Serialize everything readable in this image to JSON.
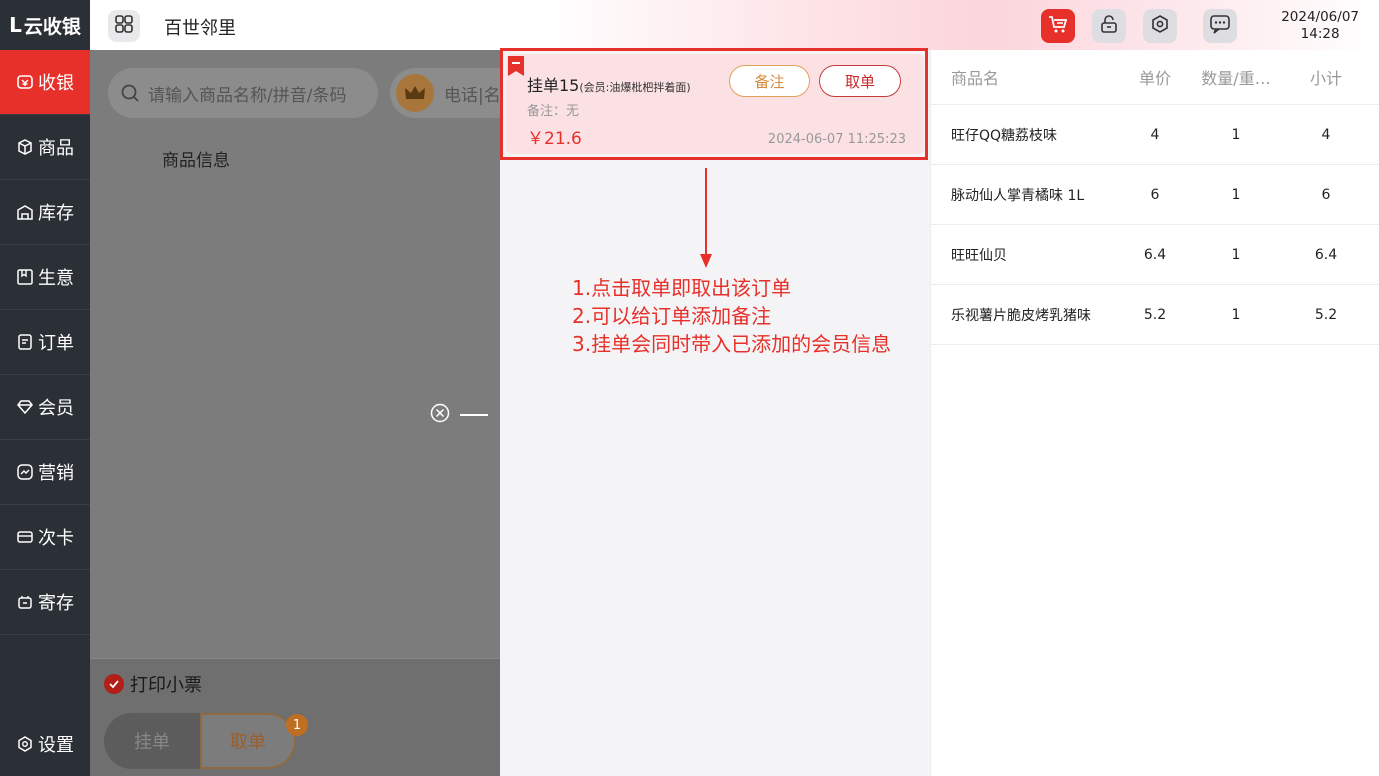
{
  "app": {
    "logo_mark": "L",
    "logo_text": "云收银"
  },
  "sidebar": {
    "items": [
      {
        "label": "收银",
        "icon": "cashier-icon",
        "active": true
      },
      {
        "label": "商品",
        "icon": "box-icon"
      },
      {
        "label": "库存",
        "icon": "warehouse-icon"
      },
      {
        "label": "生意",
        "icon": "chart-icon"
      },
      {
        "label": "订单",
        "icon": "order-icon"
      },
      {
        "label": "会员",
        "icon": "diamond-icon"
      },
      {
        "label": "营销",
        "icon": "marketing-icon"
      },
      {
        "label": "次卡",
        "icon": "card-icon"
      },
      {
        "label": "寄存",
        "icon": "locker-icon"
      }
    ],
    "settings": {
      "label": "设置",
      "icon": "gear-icon"
    }
  },
  "topbar": {
    "store_name": "百世邻里",
    "date": "2024/06/07",
    "time": "14:28",
    "icons": [
      "cart-icon",
      "lock-icon",
      "settings-icon",
      "message-icon"
    ]
  },
  "main": {
    "search_placeholder": "请输入商品名称/拼音/条码",
    "member_placeholder": "电话|名称",
    "goods_info": "商品信息",
    "print_receipt": "打印小票",
    "hang_label": "挂单",
    "take_label": "取单",
    "badge_count": "1"
  },
  "order_card": {
    "title": "挂单15",
    "member": "(会员:油爆枇杷拌着面)",
    "note": "备注：无",
    "price": "￥21.6",
    "time": "2024-06-07 11:25:23",
    "note_button": "备注",
    "take_button": "取单"
  },
  "annotation": {
    "line1": "1.点击取单即取出该订单",
    "line2": "2.可以给订单添加备注",
    "line3": "3.挂单会同时带入已添加的会员信息"
  },
  "table": {
    "headers": [
      "商品名",
      "单价",
      "数量/重…",
      "小计"
    ],
    "rows": [
      {
        "name": "旺仔QQ糖荔枝味",
        "price": "4",
        "qty": "1",
        "subtotal": "4"
      },
      {
        "name": "脉动仙人掌青橘味 1L",
        "price": "6",
        "qty": "1",
        "subtotal": "6"
      },
      {
        "name": "旺旺仙贝",
        "price": "6.4",
        "qty": "1",
        "subtotal": "6.4"
      },
      {
        "name": "乐视薯片脆皮烤乳猪味",
        "price": "5.2",
        "qty": "1",
        "subtotal": "5.2"
      }
    ]
  },
  "colors": {
    "accent": "#e8302a",
    "sidebar": "#2b2f36"
  }
}
